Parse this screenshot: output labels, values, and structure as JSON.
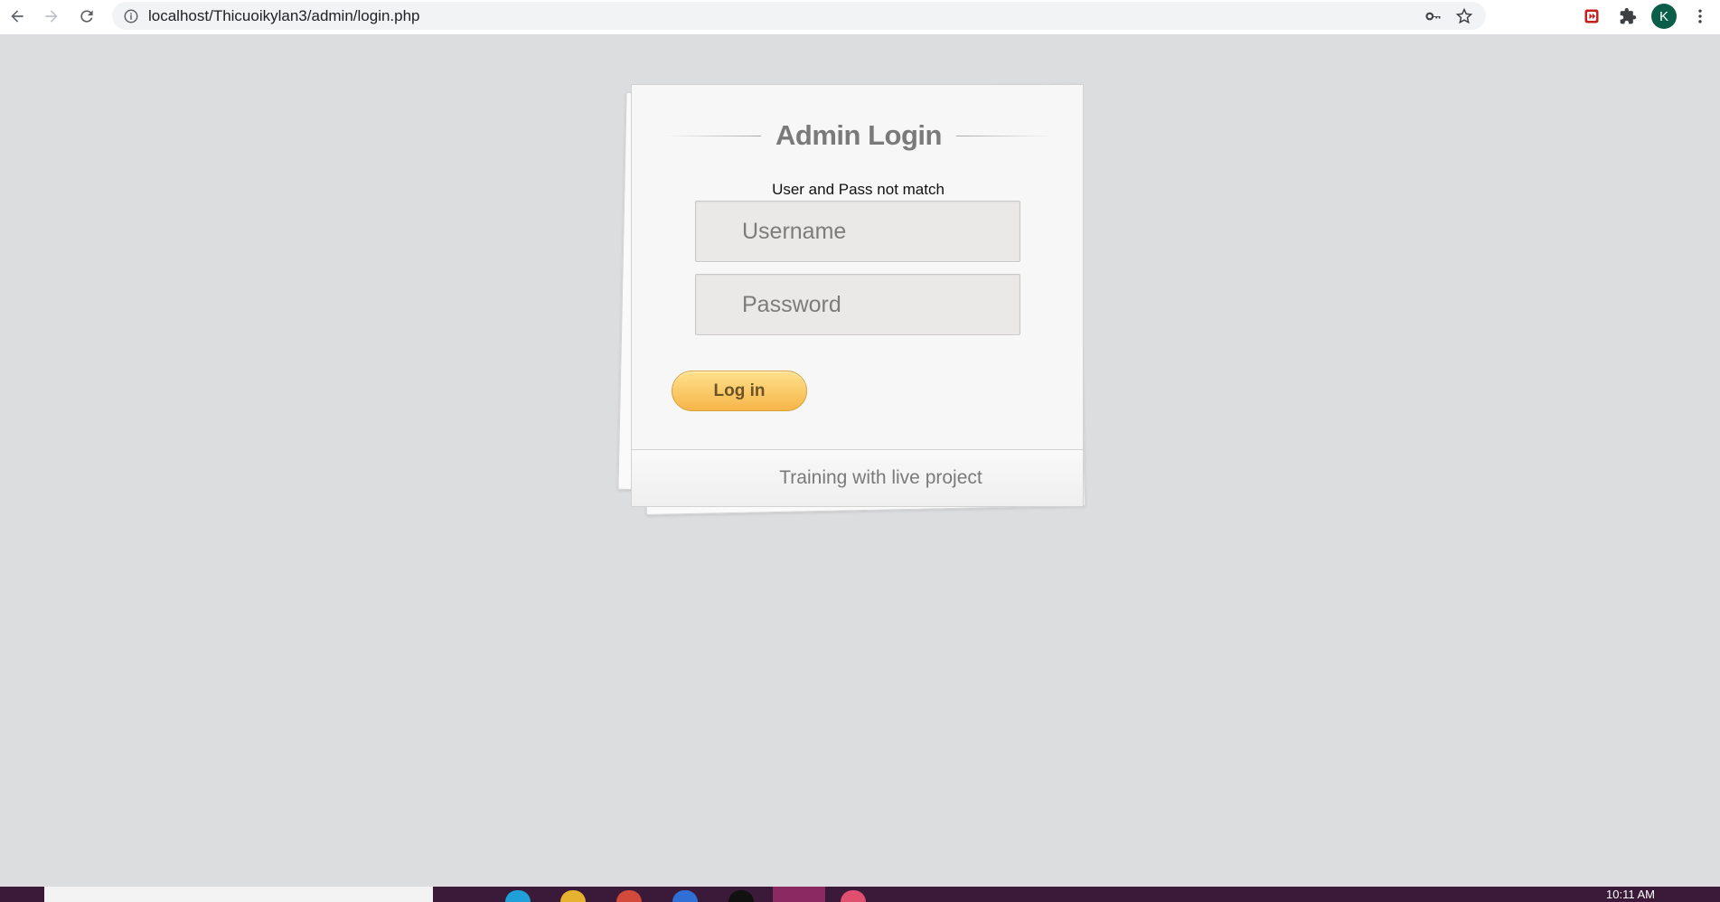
{
  "browser": {
    "url": "localhost/Thicuoikylan3/admin/login.php",
    "profile_initial": "K"
  },
  "login": {
    "title": "Admin Login",
    "error_message": "User and Pass not match",
    "username_placeholder": "Username",
    "password_placeholder": "Password",
    "submit_label": "Log in",
    "footer_text": "Training with live project"
  },
  "taskbar": {
    "clock_time": "10:11 AM"
  },
  "colors": {
    "page_background": "#dcdddf",
    "button_gradient_top": "#ffe08c",
    "button_gradient_bottom": "#f6b64a",
    "title_color": "#7a7a7a",
    "taskbar": "#3a1a38"
  },
  "icons": [
    "back-icon",
    "forward-icon",
    "reload-icon",
    "info-icon",
    "key-icon",
    "star-icon",
    "extension-red-icon",
    "puzzle-icon",
    "kebab-menu-icon"
  ]
}
